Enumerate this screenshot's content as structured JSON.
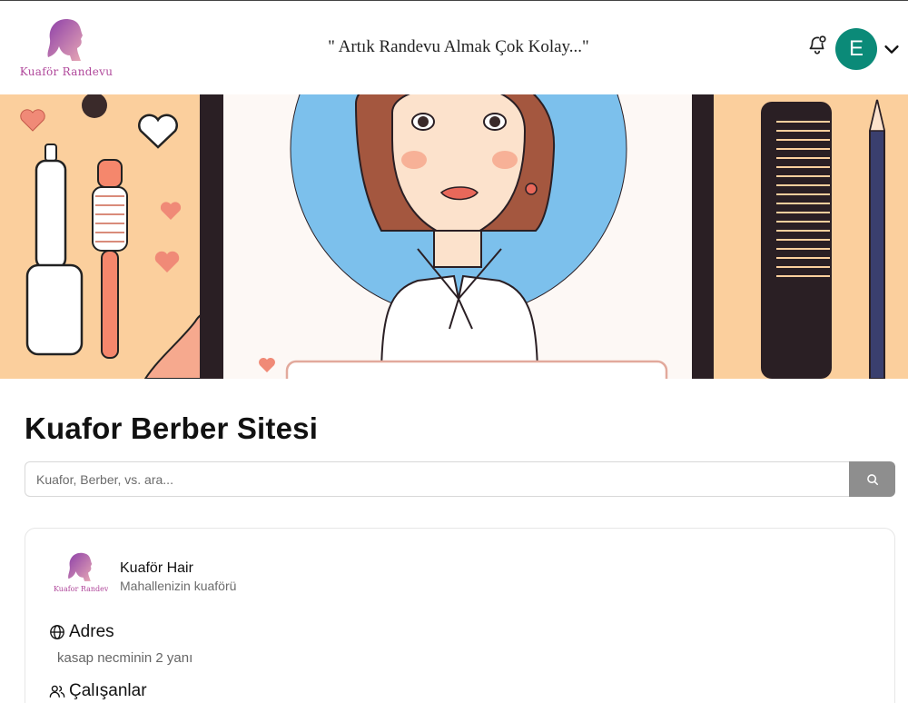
{
  "header": {
    "logo_text": "Kuaför Randevu",
    "slogan": "\" Artık Randevu Almak Çok Kolay...\"",
    "avatar_letter": "E"
  },
  "page": {
    "title": "Kuafor Berber Sitesi"
  },
  "search": {
    "placeholder": "Kuafor, Berber, vs. ara..."
  },
  "salon": {
    "logo_text": "Kuafor Randevu",
    "name": "Kuaför Hair",
    "subtitle": "Mahallenizin kuaförü",
    "address_label": "Adres",
    "address": "kasap necminin 2 yanı",
    "staff_label": "Çalışanlar"
  },
  "icons": {
    "bell": "bell-icon",
    "avatar_menu": "chevron-down-icon",
    "search": "search-icon",
    "address": "globe-icon",
    "staff": "users-icon"
  },
  "colors": {
    "avatar": "#0b8a78",
    "logo": "#b0489b",
    "search_button": "#8e8e8e",
    "banner_bg": "#fcd7a9",
    "banner_circle": "#7cc0ec"
  }
}
